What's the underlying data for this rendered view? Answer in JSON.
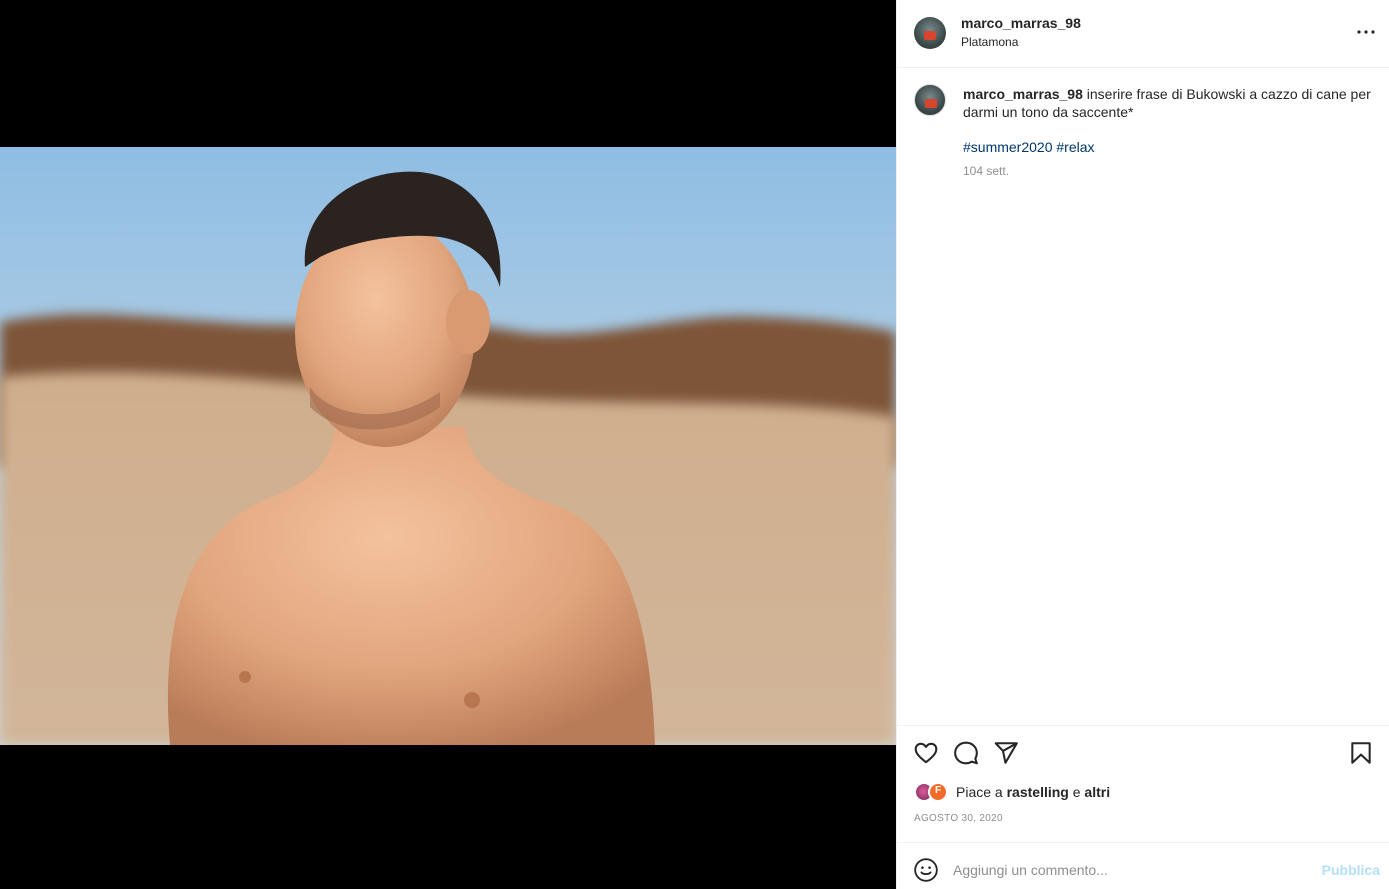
{
  "post": {
    "username": "marco_marras_98",
    "location": "Platamona"
  },
  "caption": {
    "username": "marco_marras_98",
    "text": "inserire frase di Bukowski a cazzo di cane per darmi un tono da saccente*",
    "hashtags": [
      "#summer2020",
      "#relax"
    ],
    "age": "104 sett."
  },
  "likes": {
    "prefix": "Piace a",
    "user": "rastelling",
    "conjunction": "e",
    "others": "altri"
  },
  "date": "AGOSTO 30, 2020",
  "comment": {
    "placeholder": "Aggiungi un commento...",
    "publish_label": "Pubblica"
  },
  "icons": {
    "more": "more-options-icon",
    "like": "heart-icon",
    "comment": "comment-bubble-icon",
    "share": "paper-plane-icon",
    "save": "bookmark-icon",
    "emoji": "emoji-smile-icon"
  },
  "colors": {
    "link": "#00376b",
    "muted": "#8e8e8e",
    "publish_disabled": "#b2dffc",
    "text": "#262626"
  }
}
